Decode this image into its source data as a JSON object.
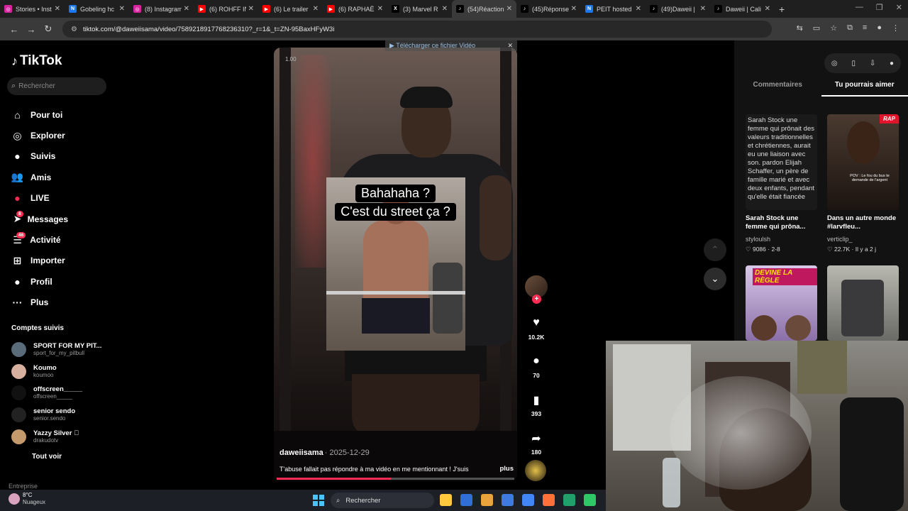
{
  "browser": {
    "tabs": [
      {
        "label": "Stories • Inst",
        "color": "#d6249f",
        "glyph": "◎"
      },
      {
        "label": "Gobeling hc",
        "color": "#1877f2",
        "glyph": "N"
      },
      {
        "label": "(8) Instagram",
        "color": "#d6249f",
        "glyph": "◎"
      },
      {
        "label": "(6) ROHFF IN",
        "color": "#ff0000",
        "glyph": "▶"
      },
      {
        "label": "(6) Le trailer",
        "color": "#ff0000",
        "glyph": "▶"
      },
      {
        "label": "(6) RAPHAË",
        "color": "#ff0000",
        "glyph": "▶"
      },
      {
        "label": "(3) Marvel R",
        "color": "#000000",
        "glyph": "X"
      },
      {
        "label": "(54)Réaction",
        "color": "#000000",
        "glyph": "♪",
        "active": true
      },
      {
        "label": "(45)Réponse",
        "color": "#000000",
        "glyph": "♪"
      },
      {
        "label": "PEIT hosted",
        "color": "#1877f2",
        "glyph": "N"
      },
      {
        "label": "(49)Daweii |",
        "color": "#000000",
        "glyph": "♪"
      },
      {
        "label": "Daweii | Cali",
        "color": "#000000",
        "glyph": "♪"
      }
    ],
    "url": "tiktok.com/@daweiisama/video/7589218917768236310?_r=1&_t=ZN-95BaxHFyW3i"
  },
  "sidebar": {
    "logo": "TikTok",
    "search_placeholder": "Rechercher",
    "nav": [
      {
        "label": "Pour toi",
        "icon": "⌂",
        "name": "home"
      },
      {
        "label": "Explorer",
        "icon": "◎",
        "name": "explore"
      },
      {
        "label": "Suivis",
        "icon": "●",
        "name": "following"
      },
      {
        "label": "Amis",
        "icon": "👥",
        "name": "friends"
      },
      {
        "label": "LIVE",
        "icon": "●",
        "name": "live"
      },
      {
        "label": "Messages",
        "icon": "➤",
        "name": "messages",
        "badge": "8"
      },
      {
        "label": "Activité",
        "icon": "☰",
        "name": "activity",
        "badge": "46"
      },
      {
        "label": "Importer",
        "icon": "⊞",
        "name": "upload"
      },
      {
        "label": "Profil",
        "icon": "●",
        "name": "profile"
      },
      {
        "label": "Plus",
        "icon": "···",
        "name": "more"
      }
    ],
    "followed_title": "Comptes suivis",
    "followed": [
      {
        "name": "SPORT FOR MY PIT...",
        "handle": "sport_for_my_pitbull",
        "color": "#5a6b7a"
      },
      {
        "name": "Koumo",
        "handle": "koumoo",
        "color": "#d8b0a0"
      },
      {
        "name": "offscreen_____",
        "handle": "offscreen_____",
        "color": "#111111"
      },
      {
        "name": "senior sendo",
        "handle": "senior.sendo",
        "color": "#222222"
      },
      {
        "name": "Yazzy Silver 🏻",
        "handle": "drakudotv",
        "color": "#c49a6c"
      }
    ],
    "see_all": "Tout voir",
    "footer": "Entreprise"
  },
  "video": {
    "timecode": "1.00",
    "caption_line1": "Bahahaha ?",
    "caption_line2": "C'est du street ça ?",
    "author": "daweiisama",
    "date": "· 2025-12-29",
    "description": "T'abuse fallait pas répondre à ma vidéo en me mentionnant ! J'suis",
    "more": "plus",
    "progress": 0.48,
    "download_banner": "▶ Télécharger ce fichier Vidéo"
  },
  "actions": {
    "likes": "10.2K",
    "comments": "70",
    "saves": "393",
    "shares": "180"
  },
  "right_panel": {
    "tabs": [
      "Commentaires",
      "Tu pourrais aimer"
    ],
    "active_tab": 1,
    "cards": [
      {
        "thumb_text": "Sarah Stock une femme qui prônait des valeurs traditionnelles et chrétiennes, aurait eu une liaison avec son. pardon Elijah Schaffer, un père de famille marié et avec deux enfants, pendant qu'elle était fiancée",
        "title": "Sarah Stock une femme qui prôna...",
        "user": "styloulsh",
        "meta": "♡ 9086 · 2-8"
      },
      {
        "tag": "RAP",
        "pov": "POV : Le fou du bus te demande de l'argent",
        "title": "Dans un autre monde #larvfleu...",
        "user": "verticlip_",
        "meta": "♡ 22.7K · Il y a 2 j"
      }
    ],
    "card3_title": "DEVINE LA RÈGLE"
  },
  "taskbar": {
    "temp": "8°C",
    "condition": "Nuageux",
    "search": "Rechercher",
    "apps": [
      "#ffc83d",
      "#2f6fd6",
      "#e8a33a",
      "#3d7be0",
      "#4285f4",
      "#ff7139",
      "#22a06b",
      "#2ec866"
    ]
  }
}
